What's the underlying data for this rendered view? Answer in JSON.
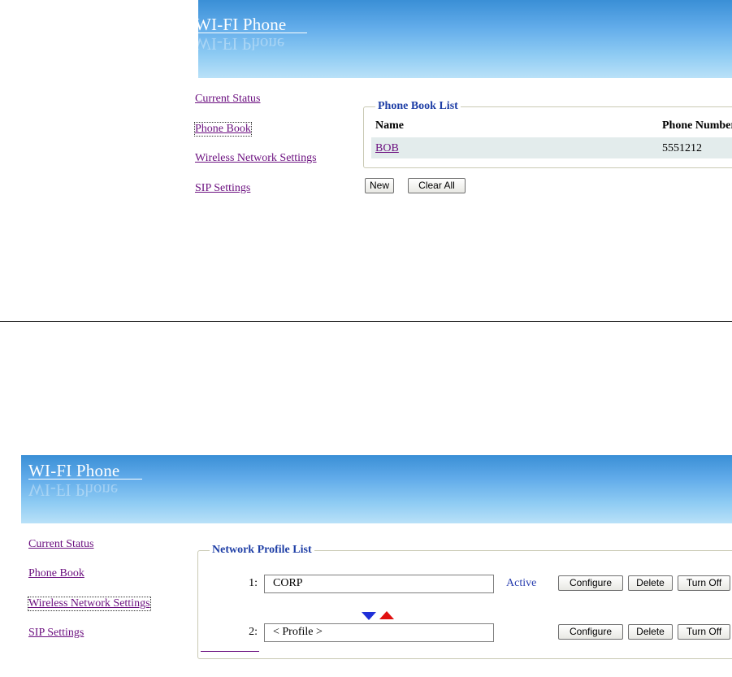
{
  "top_panel": {
    "banner_title": "WI-FI Phone",
    "nav": [
      {
        "label": "Current Status"
      },
      {
        "label": "Phone Book"
      },
      {
        "label": "Wireless Network Settings"
      },
      {
        "label": "SIP Settings"
      }
    ],
    "phonebook": {
      "legend": "Phone Book List",
      "columns": [
        "Name",
        "Phone Number"
      ],
      "rows": [
        {
          "name": "BOB",
          "phone": "5551212"
        }
      ]
    },
    "buttons": {
      "new": "New",
      "clear_all": "Clear All"
    }
  },
  "bottom_panel": {
    "banner_title": "WI-FI Phone",
    "nav": [
      {
        "label": "Current Status"
      },
      {
        "label": "Phone Book"
      },
      {
        "label": "Wireless Network Settings"
      },
      {
        "label": "SIP Settings"
      }
    ],
    "network_profiles": {
      "legend": "Network Profile List",
      "profiles": [
        {
          "index": "1:",
          "name": "CORP",
          "status": "Active"
        },
        {
          "index": "2:",
          "name": "< Profile >",
          "status": ""
        }
      ],
      "buttons": {
        "configure": "Configure",
        "delete": "Delete",
        "turn_off": "Turn Off"
      },
      "reorder_icons": [
        "move-down-icon",
        "move-up-icon"
      ]
    }
  },
  "colors": {
    "link": "#6b0f7f",
    "legend": "#1f3fa6",
    "active_status": "#2a3fb0",
    "row_highlight": "#e3ecec",
    "move_down": "#1f2fd8",
    "move_up": "#e01010"
  }
}
